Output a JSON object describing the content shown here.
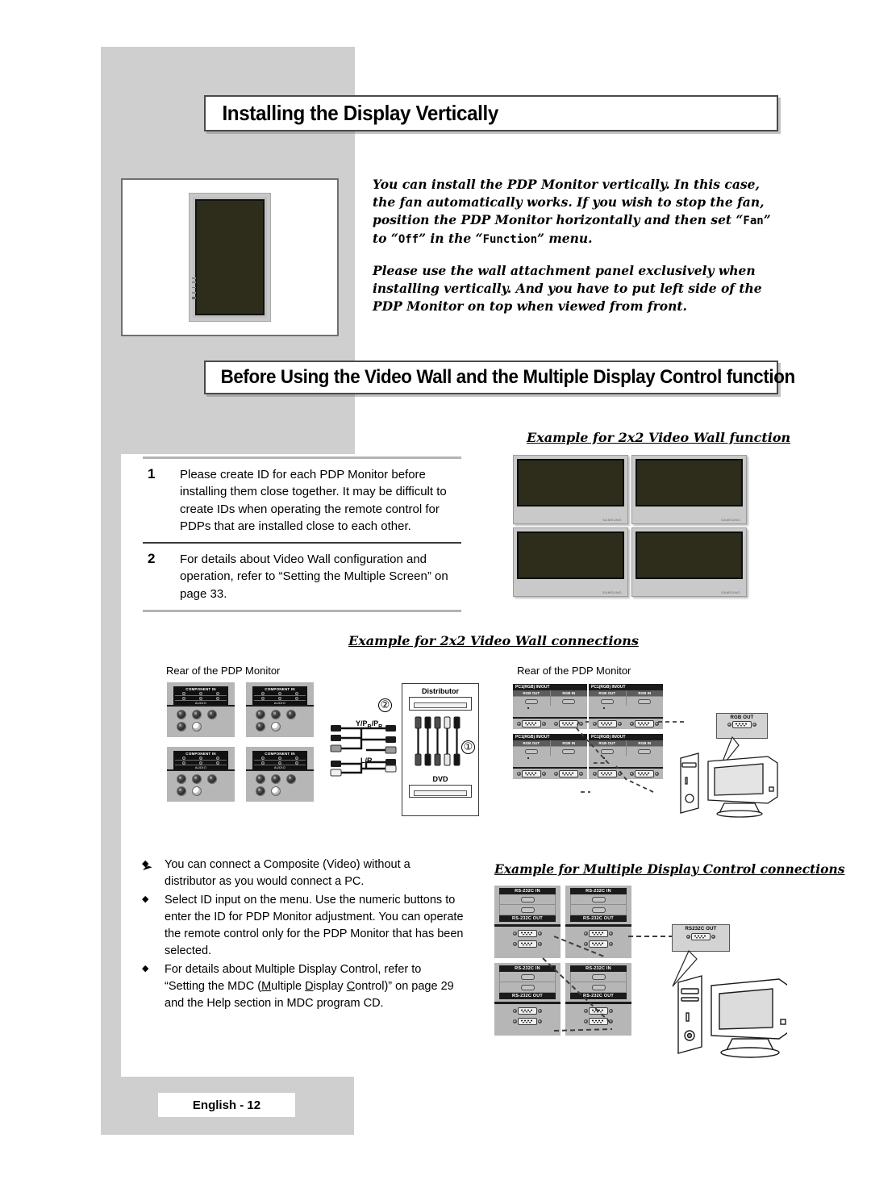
{
  "page": {
    "footer_label": "English - 12"
  },
  "sections": {
    "heading_1": "Installing the Display Vertically",
    "heading_2": "Before Using the Video Wall and the Multiple Display Control function"
  },
  "intro": {
    "paragraph_1_part1": "You can install the PDP Monitor vertically. In this case, the fan automatically works. If you wish to stop the fan, position the PDP Monitor horizontally and then set “",
    "paragraph_1_mono1": "Fan",
    "paragraph_1_part2": "” to “",
    "paragraph_1_mono2": "Off",
    "paragraph_1_part3": "” in the “",
    "paragraph_1_mono3": "Function",
    "paragraph_1_part4": "” menu.",
    "paragraph_2": "Please use the wall attachment panel exclusively when installing vertically. And you have to put left side of the PDP Monitor on top when viewed from front."
  },
  "numbered_list": [
    {
      "number": "1",
      "text": "Please create ID for each PDP Monitor before installing them close together. It may be difficult to create IDs when operating the remote control for PDPs that are installed close to each other."
    },
    {
      "number": "2",
      "text": "For details about Video Wall configuration and operation, refer to “Setting the Multiple Screen” on page 33."
    }
  ],
  "captions": {
    "video_wall_function": "Example for 2x2 Video Wall function",
    "video_wall_connections": "Example for 2x2 Video Wall connections",
    "mdc_connections": "Example for Multiple Display Control connections"
  },
  "diagram_labels": {
    "rear_left": "Rear of the PDP Monitor",
    "rear_right": "Rear of the PDP Monitor",
    "component_in": "COMPONENT IN",
    "audio": "AUDIO",
    "ypbpr": "Y/PB/PR",
    "lr": "L/R",
    "distributor": "Distributor",
    "dvd": "DVD",
    "marker_1": "①",
    "marker_2": "②",
    "pc1_rgb": "PC1(RGB) IN/OUT",
    "rgb_out": "RGB OUT",
    "rgb_in": "RGB IN",
    "rgb_out_callout": "RGB OUT",
    "rs232c_in": "RS-232C IN",
    "rs232c_out": "RS-232C OUT",
    "rs232c_out_callout": "RS232C OUT"
  },
  "bullets": {
    "arrow": "➢",
    "marker": "◆",
    "items": [
      "You can connect a Composite (Video) without a distributor as you would connect a PC.",
      "Select ID input on the menu. Use the numeric buttons to enter the ID for PDP Monitor adjustment. You can operate the remote control only for the PDP Monitor that has been selected.",
      "For details about Multiple Display Control, refer to “Setting the MDC (Multiple Display Control)” on page 29 and the Help section in MDC program CD."
    ],
    "item3_pre": "For details about Multiple Display Control, refer to “Setting the MDC (",
    "item3_u1": "M",
    "item3_mid1": "ultiple ",
    "item3_u2": "D",
    "item3_mid2": "isplay ",
    "item3_u3": "C",
    "item3_post": "ontrol)” on page 29 and the Help section in MDC program CD."
  },
  "monitor_brand": "SAMSUNG",
  "colors": {
    "panel_gray": "#cfcfcf",
    "screen_dark": "#2e2d1c",
    "device_gray": "#b6b6b6",
    "rule_gray": "#b4b4b4"
  }
}
